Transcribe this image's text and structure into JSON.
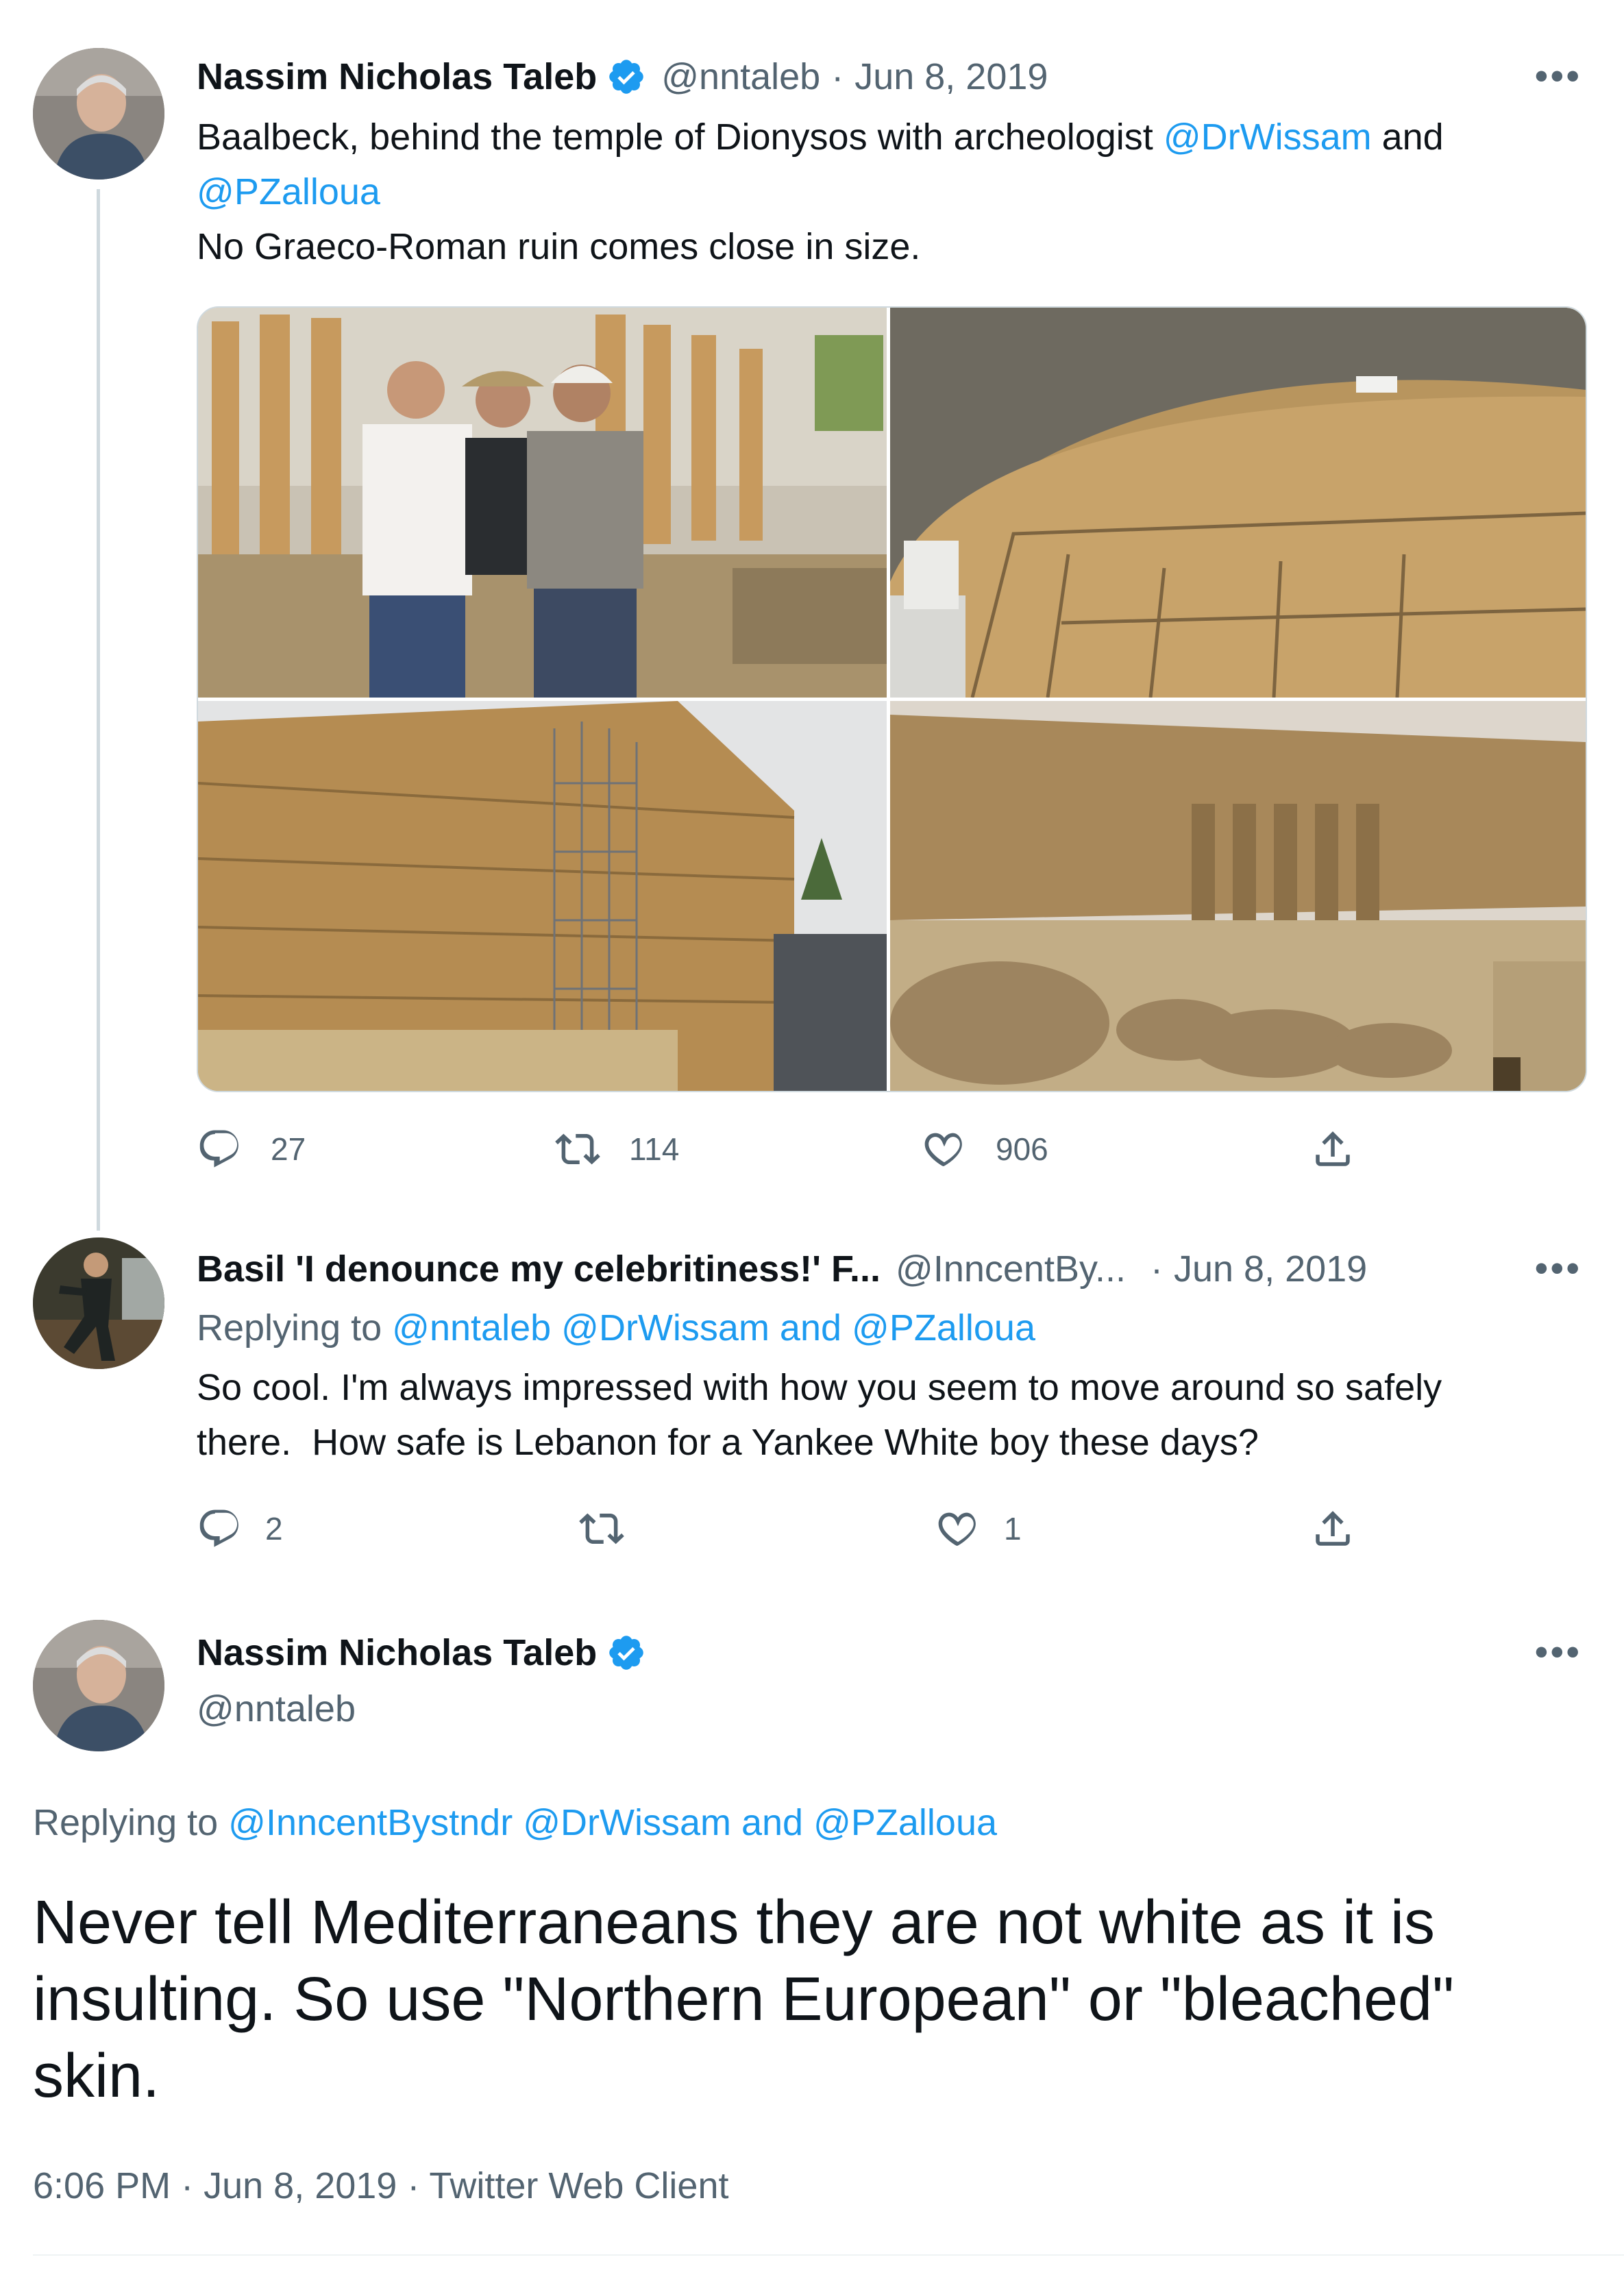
{
  "colors": {
    "link": "#1d9bf0",
    "muted": "#536471",
    "text": "#0f1419",
    "divider": "#cfd9de",
    "verified": "#1d9bf0"
  },
  "tweet1": {
    "name": "Nassim Nicholas Taleb",
    "handle": "@nntaleb",
    "dot": "·",
    "date": "Jun 8, 2019",
    "more": "•••",
    "text_line1_prefix": "Baalbeck, behind the temple of Dionysos with archeologist ",
    "mention1": "@DrWissam",
    "and": " and",
    "mention2": "@PZalloua",
    "text_line3": "No Graeco-Roman ruin comes close in size.",
    "replies": "27",
    "retweets": "114",
    "likes": "906",
    "icons": {
      "reply": "reply-icon",
      "retweet": "retweet-icon",
      "like": "heart-icon",
      "share": "share-icon",
      "verified": "verified-badge-icon"
    }
  },
  "tweet2": {
    "name": "Basil 'I denounce my celebritiness!' F...",
    "handle": "@InncentBy...",
    "dot": "·",
    "date": "Jun 8, 2019",
    "more": "•••",
    "replying_to": "Replying to ",
    "mentions": "@nntaleb @DrWissam and @PZalloua",
    "text_line1": "So cool. I'm always impressed with how you seem to move around so safely",
    "text_line2": "there.  How safe is Lebanon for a Yankee White boy these days?",
    "replies": "2",
    "retweets": "",
    "likes": "1"
  },
  "tweet3": {
    "name": "Nassim Nicholas Taleb",
    "handle": "@nntaleb",
    "more": "•••",
    "replying_to": "Replying to ",
    "mentions": "@InncentBystndr @DrWissam and @PZalloua",
    "text_line1": "Never tell Mediterraneans they are not white as it is",
    "text_line2": "insulting. So use \"Northern European\" or \"bleached\"",
    "text_line3": "skin.",
    "meta": "6:06 PM · Jun 8, 2019 · Twitter Web Client"
  }
}
